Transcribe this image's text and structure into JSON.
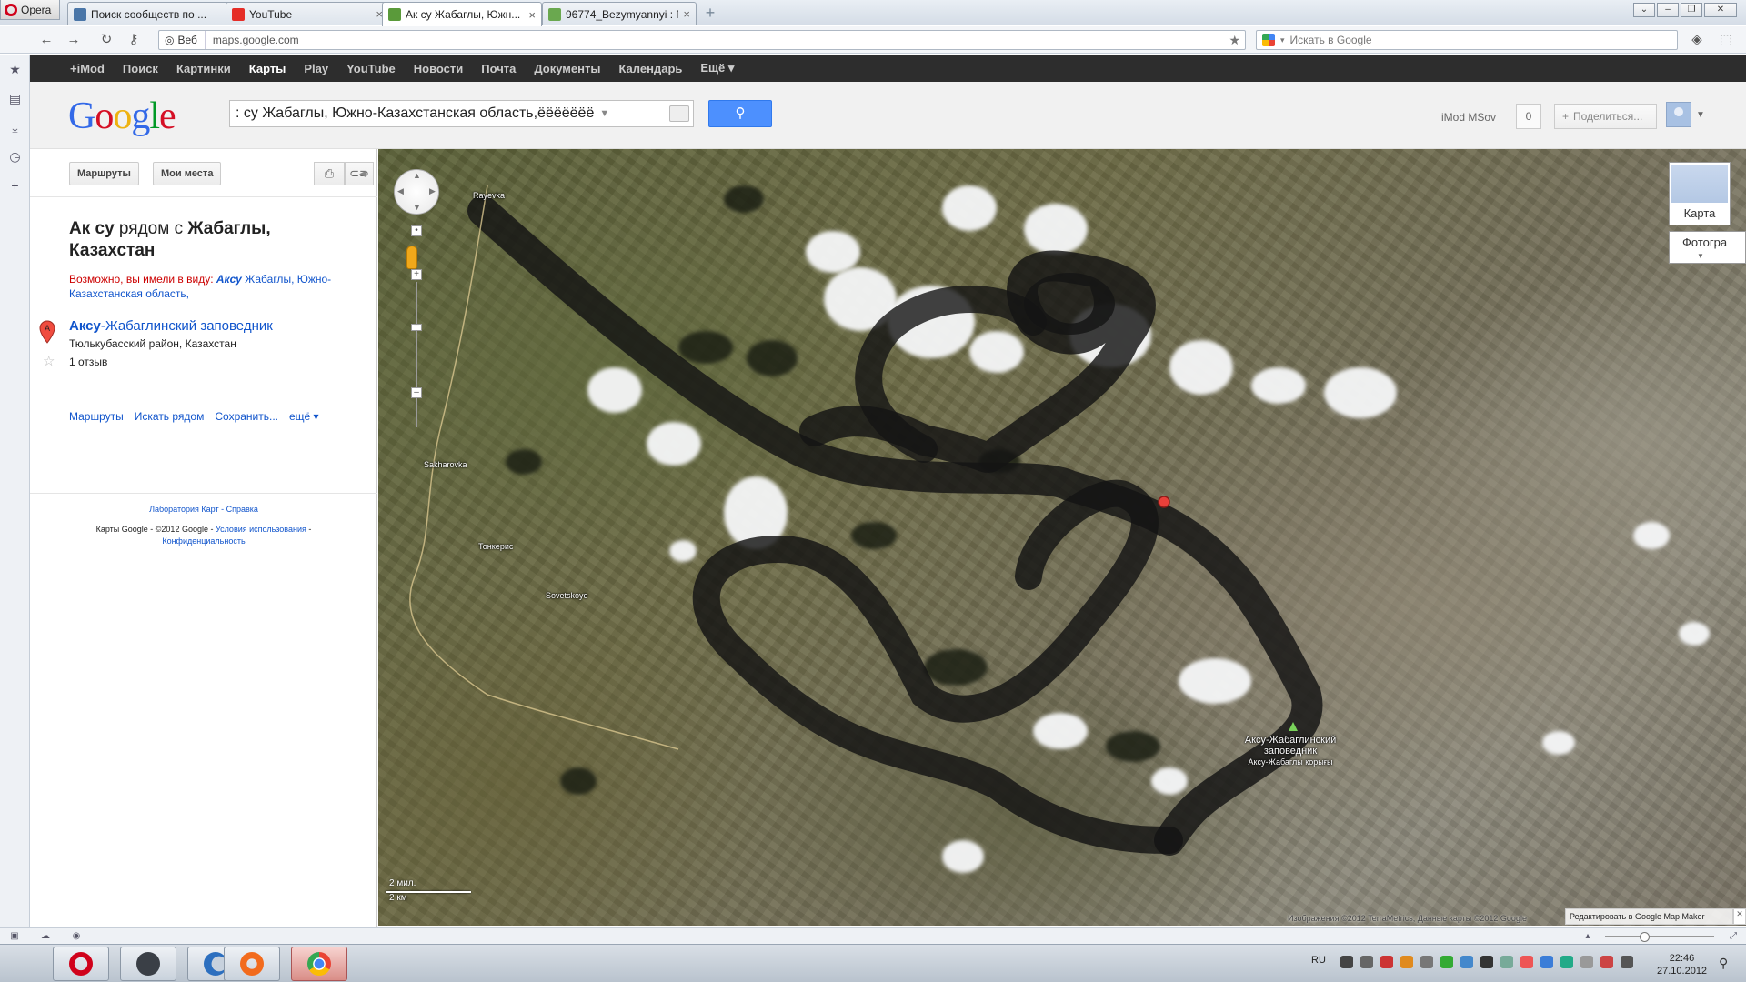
{
  "browser": {
    "app_label": "Opera",
    "tabs": [
      {
        "title": "Поиск сообществ по ...",
        "favicon_color": "#4a76a8"
      },
      {
        "title": "YouTube",
        "favicon_color": "#e52d27"
      },
      {
        "title": "Ак су Жабаглы, Южн...",
        "favicon_color": "#5a9a3a",
        "active": true
      },
      {
        "title": "96774_Bezymyannyi : П...",
        "favicon_color": "#6aa84f"
      }
    ],
    "address": {
      "security_label": "Веб",
      "url": "maps.google.com"
    },
    "search_placeholder": "Искать в Google"
  },
  "google_bar": {
    "items": [
      "+iMod",
      "Поиск",
      "Картинки",
      "Карты",
      "Play",
      "YouTube",
      "Новости",
      "Почта",
      "Документы",
      "Календарь",
      "Ещё ▾"
    ],
    "active": "Карты"
  },
  "header": {
    "logo": [
      "G",
      "o",
      "o",
      "g",
      "l",
      "e"
    ],
    "logo_colors": [
      "#3369e8",
      "#d50f25",
      "#eeb211",
      "#3369e8",
      "#009925",
      "#d50f25"
    ],
    "query": ": су Жабаглы, Южно-Казахстанская область,ёёёёёёё",
    "user_name": "iMod MSov",
    "notifications": "0",
    "share_label": "Поделиться..."
  },
  "panel": {
    "buttons": {
      "routes": "Маршруты",
      "my_places": "Мои места"
    },
    "result_title_a": "Ак су",
    "result_title_b": " рядом с ",
    "result_title_c": "Жабаглы, Казахстан",
    "maybe_prefix": "Возможно, вы имели в виду: ",
    "maybe_bold": "Аксу",
    "maybe_link": " Жабаглы, Южно-Казахстанская область,",
    "place_marker": "A",
    "place_name_bold": "Аксу",
    "place_name_rest": "-Жабаглинский заповедник",
    "place_region": "Тюлькубасский район, Казахстан",
    "reviews": "1 отзыв",
    "actions": [
      "Маршруты",
      "Искать рядом",
      "Сохранить...",
      "ещё ▾"
    ],
    "footer_links": "Лаборатория Карт - Справка",
    "footer_copy": "Карты Google - ©2012 Google - ",
    "footer_terms": "Условия использования",
    "footer_sep": " - ",
    "footer_privacy": "Конфиденциальность"
  },
  "map": {
    "type_map": "Карта",
    "type_sat": "Фотогра",
    "labels": {
      "rayevka": "Rayevka",
      "sakharovka": "Sakharovka",
      "tonkeris": "Тонкерис",
      "sovetskoye": "Sovetskoye"
    },
    "poi_name": "Аксу-Жабаглинский заповедник",
    "poi_sub": "Аксу-Жабаглы корығы",
    "scale_mi": "2 мил.",
    "scale_km": "2 км",
    "copyright": "Изображения ©2012 TerraMetrics, Данные карты ©2012 Google",
    "mapmaker": "Редактировать в Google Map Maker"
  },
  "taskbar": {
    "lang": "RU",
    "time": "22:46",
    "date": "27.10.2012"
  }
}
